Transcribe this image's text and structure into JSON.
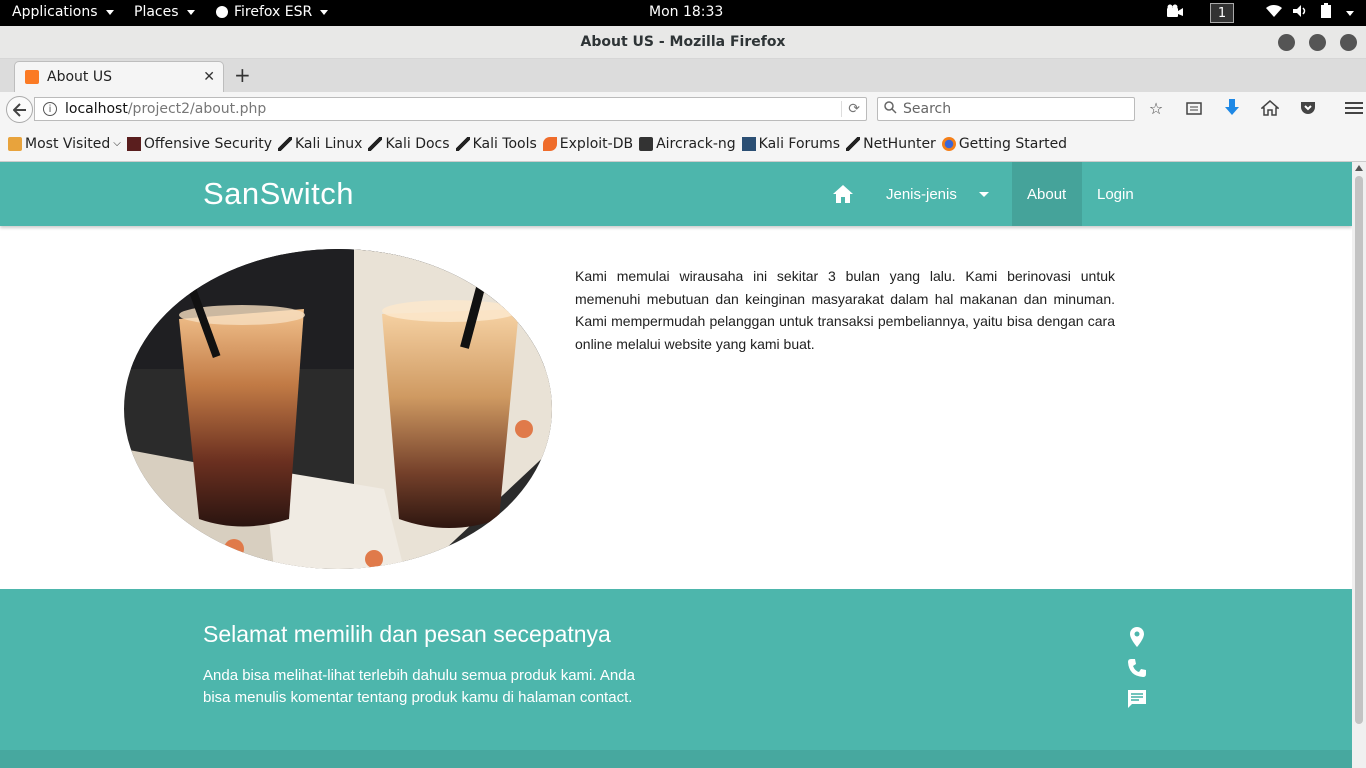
{
  "system_bar": {
    "applications": "Applications",
    "places": "Places",
    "firefox": "Firefox ESR",
    "clock": "Mon 18:33",
    "workspace": "1"
  },
  "window": {
    "title": "About US - Mozilla Firefox"
  },
  "tab": {
    "label": "About US"
  },
  "url": {
    "host": "localhost",
    "path": "/project2/about.php"
  },
  "search": {
    "placeholder": "Search"
  },
  "bookmarks": [
    {
      "label": "Most Visited",
      "icon": "folder-icon"
    },
    {
      "label": "Offensive Security",
      "icon": "offsec-icon"
    },
    {
      "label": "Kali Linux",
      "icon": "kali-icon"
    },
    {
      "label": "Kali Docs",
      "icon": "kali-icon"
    },
    {
      "label": "Kali Tools",
      "icon": "kali-icon"
    },
    {
      "label": "Exploit-DB",
      "icon": "exploitdb-icon"
    },
    {
      "label": "Aircrack-ng",
      "icon": "aircrack-icon"
    },
    {
      "label": "Kali Forums",
      "icon": "kali-forums-icon"
    },
    {
      "label": "NetHunter",
      "icon": "kali-icon"
    },
    {
      "label": "Getting Started",
      "icon": "firefox-icon"
    }
  ],
  "site": {
    "brand": "SanSwitch",
    "nav": {
      "jenis": "Jenis-jenis",
      "about": "About",
      "login": "Login"
    },
    "about_text": "Kami memulai wirausaha ini sekitar 3 bulan yang lalu. Kami berinovasi untuk memenuhi mebutuan dan keinginan masyarakat dalam hal makanan dan minuman. Kami mempermudah pelanggan untuk transaksi pembeliannya, yaitu bisa dengan cara online melalui website yang kami buat.",
    "footer": {
      "title": "Selamat memilih dan pesan secepatnya",
      "text": "Anda bisa melihat-lihat terlebih dahulu semua produk kami. Anda bisa menulis komentar tentang produk kamu di halaman contact."
    }
  },
  "colors": {
    "teal": "#4db6ac",
    "teal_dark": "#47a89f"
  }
}
